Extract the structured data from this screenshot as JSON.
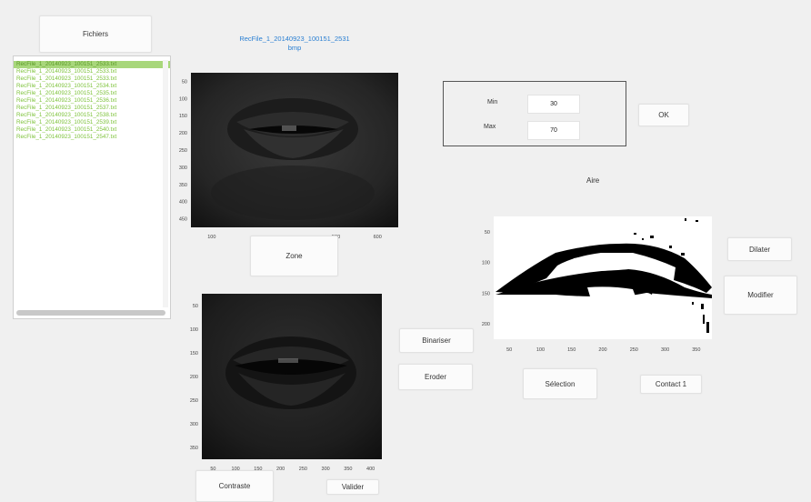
{
  "buttons": {
    "fichiers": "Fichiers",
    "zone": "Zone",
    "binariser": "Binariser",
    "eroder": "Eroder",
    "contraste": "Contraste",
    "valider": "Valider",
    "ok": "OK",
    "selection": "Sélection",
    "contact": "Contact 1",
    "dilater": "Dilater",
    "modifier": "Modifier"
  },
  "files": [
    "RecFile_1_20140923_100151_2533.txt",
    "RecFile_1_20140923_100151_2533.txt",
    "RecFile_1_20140923_100151_2533.txt",
    "RecFile_1_20140923_100151_2534.txt",
    "RecFile_1_20140923_100151_2535.txt",
    "RecFile_1_20140923_100151_2536.txt",
    "RecFile_1_20140923_100151_2537.txt",
    "RecFile_1_20140923_100151_2538.txt",
    "RecFile_1_20140923_100151_2539.txt",
    "RecFile_1_20140923_100151_2540.txt",
    "RecFile_1_20140923_100151_2547.txt"
  ],
  "image_title": {
    "line1": "RecFile_1_20140923_100151_2531",
    "line2": "bmp"
  },
  "threshold": {
    "min_label": "Min",
    "max_label": "Max",
    "min_value": "30",
    "max_value": "70"
  },
  "aire_label": "Aire",
  "axes": {
    "top": {
      "y": [
        "50",
        "100",
        "150",
        "200",
        "250",
        "300",
        "350",
        "400",
        "450"
      ],
      "x": [
        "100",
        "",
        "",
        "500",
        "600"
      ]
    },
    "bottom": {
      "y": [
        "50",
        "100",
        "150",
        "200",
        "250",
        "300",
        "350"
      ],
      "x": [
        "50",
        "100",
        "150",
        "200",
        "250",
        "300",
        "350",
        "400"
      ]
    },
    "right": {
      "y": [
        "50",
        "100",
        "150",
        "200"
      ],
      "x": [
        "50",
        "100",
        "150",
        "200",
        "250",
        "300",
        "350"
      ]
    }
  }
}
